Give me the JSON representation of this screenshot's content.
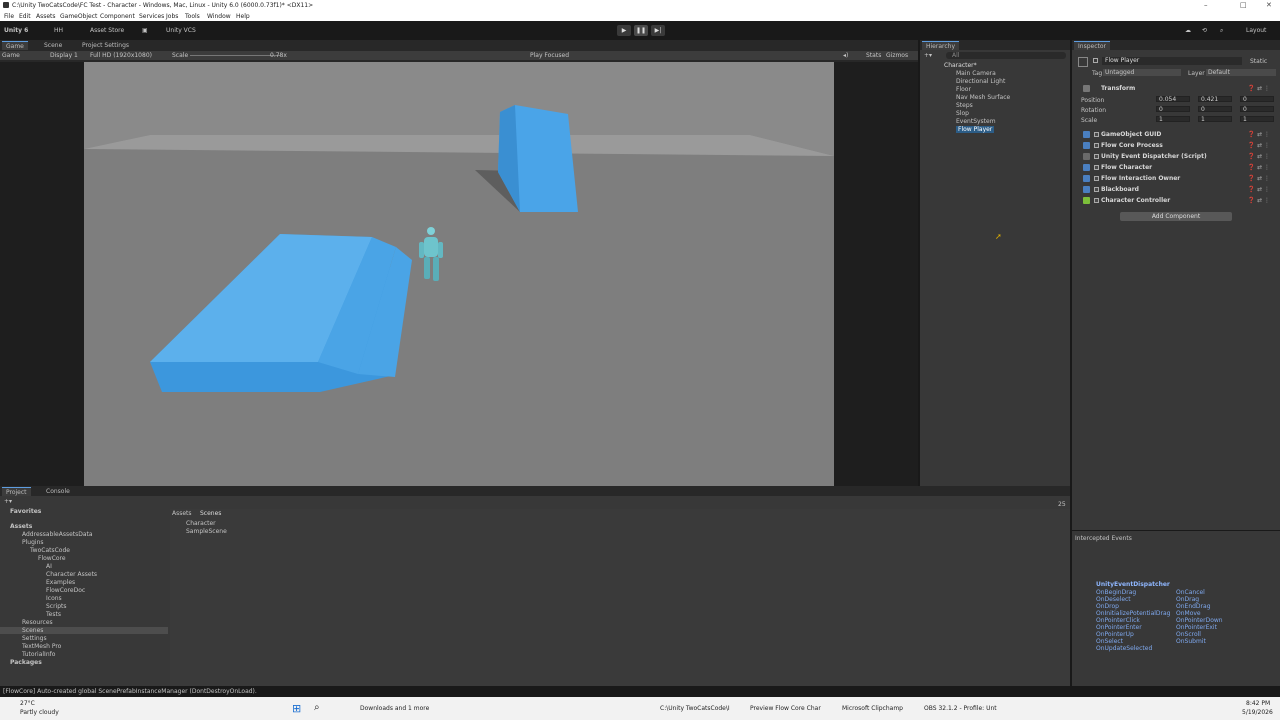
{
  "title": "C:\\Unity TwoCatsCode\\FC Test - Character - Windows, Mac, Linux - Unity 6.0 (6000.0.73f1)* <DX11>",
  "menu": [
    "File",
    "Edit",
    "Assets",
    "GameObject",
    "Component",
    "Services",
    "Jobs",
    "Tools",
    "Window",
    "Help"
  ],
  "toolbar": {
    "unity": "Unity 6",
    "account": "HH",
    "asset_store": "Asset Store",
    "vcs": "Unity VCS",
    "layout": "Layout"
  },
  "game_tabs": [
    "Game",
    "Scene",
    "Project Settings"
  ],
  "game_toolbar": {
    "view": "Game",
    "display": "Display 1",
    "resolution": "Full HD (1920x1080)",
    "scale_label": "Scale",
    "scale_value": "0.78x",
    "play_focused": "Play Focused",
    "stats": "Stats",
    "gizmos": "Gizmos"
  },
  "hierarchy": {
    "tab": "Hierarchy",
    "search": "All",
    "root": "Character*",
    "items": [
      "Main Camera",
      "Directional Light",
      "Floor",
      "Nav Mesh Surface",
      "Steps",
      "Slop",
      "EventSystem",
      "Flow Player"
    ]
  },
  "inspector": {
    "tab": "Inspector",
    "object_name": "Flow Player",
    "static": "Static",
    "tag_label": "Tag",
    "tag_value": "Untagged",
    "layer_label": "Layer",
    "layer_value": "Default",
    "transform": {
      "title": "Transform",
      "rows": [
        {
          "label": "Position",
          "x": "0.054",
          "y": "0.421",
          "z": "0"
        },
        {
          "label": "Rotation",
          "x": "0",
          "y": "0",
          "z": "0"
        },
        {
          "label": "Scale",
          "x": "1",
          "y": "1",
          "z": "1"
        }
      ]
    },
    "components": [
      "GameObject GUID",
      "Flow Core Process",
      "Unity Event Dispatcher (Script)",
      "Flow Character",
      "Flow Interaction Owner",
      "Blackboard",
      "Character Controller"
    ],
    "add_component": "Add Component",
    "intercepted": "Intercepted Events",
    "dispatcher_title": "UnityEventDispatcher",
    "events_left": [
      "OnBeginDrag",
      "OnDeselect",
      "OnDrop",
      "OnInitializePotentialDrag",
      "OnPointerClick",
      "OnPointerEnter",
      "OnPointerUp",
      "OnSelect",
      "OnUpdateSelected"
    ],
    "events_right": [
      "OnCancel",
      "OnDrag",
      "OnEndDrag",
      "OnMove",
      "OnPointerDown",
      "OnPointerExit",
      "OnScroll",
      "OnSubmit"
    ]
  },
  "project": {
    "tabs": [
      "Project",
      "Console"
    ],
    "favorites": "Favorites",
    "tree": [
      "Assets",
      "AddressableAssetsData",
      "Plugins",
      "TwoCatsCode",
      "FlowCore",
      "AI",
      "Character Assets",
      "Examples",
      "FlowCoreDoc",
      "Icons",
      "Scripts",
      "Tests",
      "Resources",
      "Scenes",
      "Settings",
      "TextMesh Pro",
      "TutorialInfo",
      "Packages"
    ],
    "breadcrumb": [
      "Assets",
      "Scenes"
    ],
    "files": [
      "Character",
      "SampleScene"
    ],
    "count": "25"
  },
  "status": "[FlowCore] Auto-created global ScenePrefabInstanceManager (DontDestroyOnLoad).",
  "taskbar": {
    "weather_temp": "27°C",
    "weather_desc": "Partly cloudy",
    "downloads": "Downloads and 1 more",
    "unity_app": "C:\\Unity TwoCatsCode\\I",
    "vs": "Preview Flow Core Char",
    "clipchamp": "Microsoft Clipchamp",
    "obs": "OBS 32.1.2 - Profile: Unt",
    "time": "8:42 PM",
    "date": "5/19/2026"
  }
}
